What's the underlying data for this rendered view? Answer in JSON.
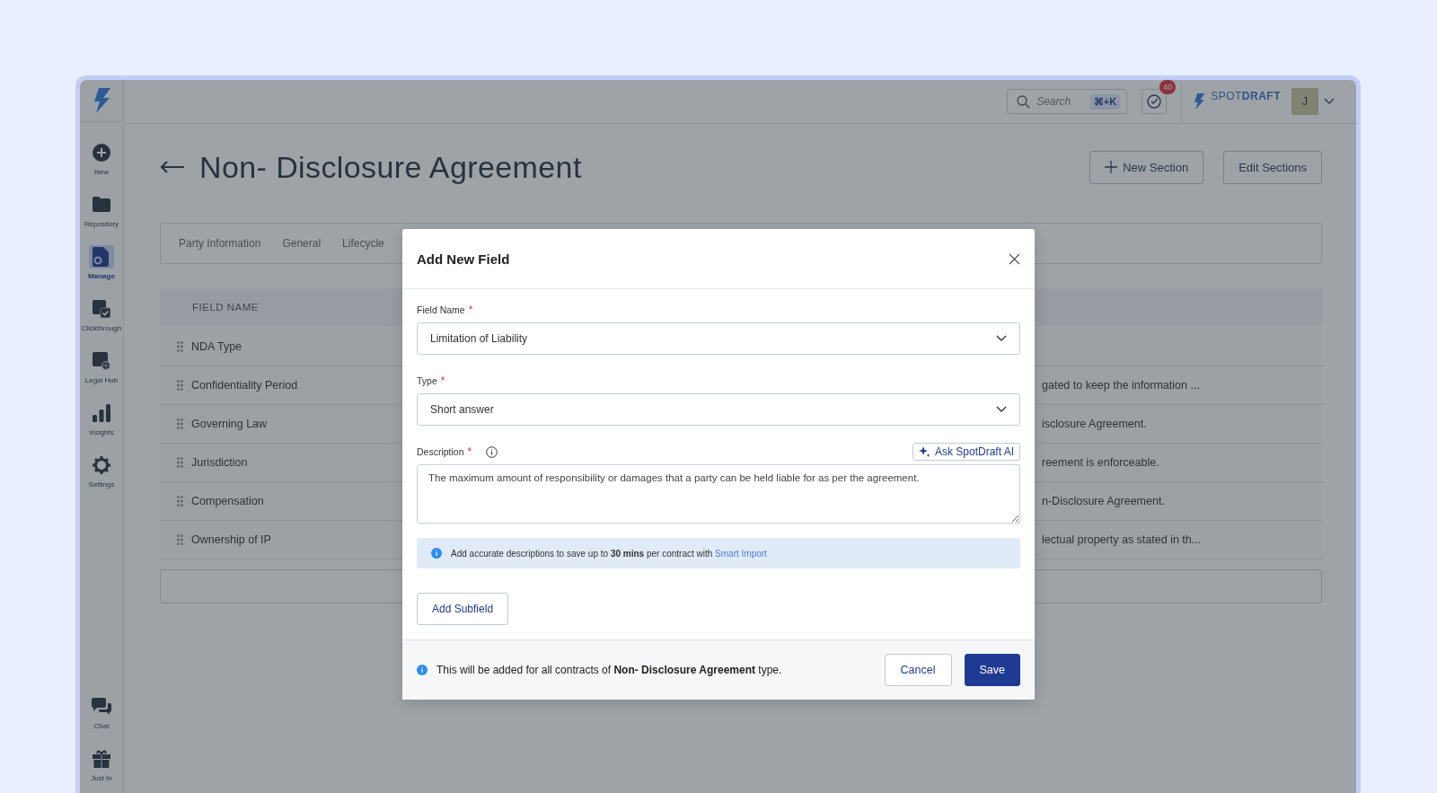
{
  "sidebar": {
    "items": [
      {
        "label": "New",
        "kind": "plus",
        "selected": false
      },
      {
        "label": "Repository",
        "kind": "folder",
        "selected": false
      },
      {
        "label": "Manage",
        "kind": "manage",
        "selected": true
      },
      {
        "label": "Clickthrough",
        "kind": "clickthrough",
        "selected": false
      },
      {
        "label": "Legal Hub",
        "kind": "hub",
        "selected": false
      },
      {
        "label": "Insights",
        "kind": "insights",
        "selected": false
      },
      {
        "label": "Settings",
        "kind": "settings",
        "selected": false
      }
    ],
    "bottom_items": [
      {
        "label": "Chat",
        "kind": "chat",
        "selected": false
      },
      {
        "label": "Just In",
        "kind": "gift",
        "selected": false
      }
    ]
  },
  "header": {
    "search": {
      "placeholder": "Search",
      "shortcut": "⌘+K"
    },
    "notifications": {
      "count": "40"
    },
    "brand": "SPOT**DRAFT**",
    "avatar": "J"
  },
  "page": {
    "title": "Non- Disclosure Agreement",
    "buttons": [
      {
        "label": "New Section",
        "kind": "add"
      },
      {
        "label": "Edit Sections",
        "kind": "plain"
      }
    ]
  },
  "tabs": [
    {
      "label": "Party Information"
    },
    {
      "label": "General"
    },
    {
      "label": "Lifecycle"
    }
  ],
  "table": {
    "columns": [
      "FIELD NAME"
    ],
    "rows": [
      {
        "name": "NDA Type"
      },
      {
        "name": "Confidentiality Period",
        "column_2": "gated to keep the information ..."
      },
      {
        "name": "Governing Law",
        "column_2": "isclosure Agreement."
      },
      {
        "name": "Jurisdiction",
        "column_2": "reement is enforceable."
      },
      {
        "name": "Compensation",
        "column_2": "n-Disclosure Agreement."
      },
      {
        "name": "Ownership of IP",
        "column_2": "lectual property as stated in th..."
      }
    ]
  },
  "dialog": {
    "title": "Add New Field",
    "fields": [
      {
        "label": "Field Name",
        "required_mark": "*",
        "kind": "select",
        "value": "Limitation of Liability"
      },
      {
        "label": "Type",
        "required_mark": "*",
        "kind": "select",
        "value": "Short answer"
      },
      {
        "label": "Description",
        "required_mark": "*",
        "kind": "textarea",
        "value": "The maximum amount of responsibility or damages that a party can be held liable for as per the agreement.",
        "ai_button": "Ask SpotDraft AI"
      }
    ],
    "banner": {
      "text": "Add accurate descriptions to save up to **30 mins** per contract with",
      "link": "Smart Import"
    },
    "add_subfield": "Add Subfield",
    "footer_note": "This will be added for all contracts of **Non- Disclosure Agreement** type.",
    "buttons": [
      {
        "label": "Cancel",
        "kind": "secondary"
      },
      {
        "label": "Save",
        "kind": "primary"
      }
    ]
  }
}
